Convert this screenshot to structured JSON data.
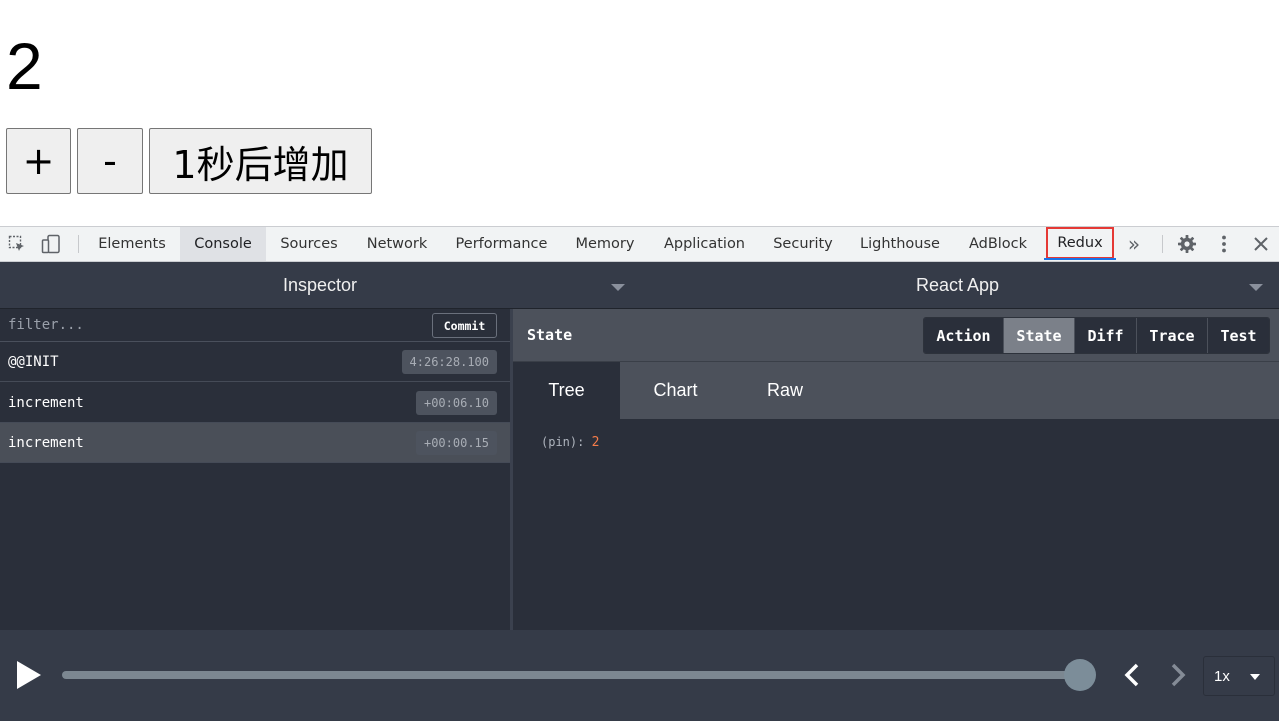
{
  "app": {
    "count": "2",
    "buttons": {
      "increment": "+",
      "decrement": "-",
      "async_increment": "1秒后增加"
    }
  },
  "devtools": {
    "tabs": [
      "Elements",
      "Console",
      "Sources",
      "Network",
      "Performance",
      "Memory",
      "Application",
      "Security",
      "Lighthouse",
      "AdBlock",
      "Redux"
    ],
    "active_tab": "Console",
    "highlighted_tab": "Redux",
    "more_label": "»",
    "icons": [
      "inspect-element-icon",
      "device-toolbar-icon",
      "more-tabs-icon",
      "settings-gear-icon",
      "kebab-menu-icon",
      "close-icon"
    ]
  },
  "redux": {
    "monitor_select": "Inspector",
    "instance_select": "React App",
    "filter_placeholder": "filter...",
    "commit_label": "Commit",
    "actions": [
      {
        "name": "@@INIT",
        "time": "4:26:28.100",
        "selected": false
      },
      {
        "name": "increment",
        "time": "+00:06.10",
        "selected": false
      },
      {
        "name": "increment",
        "time": "+00:00.15",
        "selected": true
      }
    ],
    "panel_title": "State",
    "view_tabs": [
      "Action",
      "State",
      "Diff",
      "Trace",
      "Test"
    ],
    "active_view": "State",
    "sub_tabs": [
      "Tree",
      "Chart",
      "Raw"
    ],
    "active_sub_tab": "Tree",
    "tree": {
      "key": "(pin)",
      "value": "2"
    },
    "colors": {
      "background": "#2a2f3a",
      "header": "#4c515b",
      "value": "#f57c4a",
      "highlight": "#e53935"
    },
    "player": {
      "position": 1.0,
      "speed": "1x"
    }
  }
}
